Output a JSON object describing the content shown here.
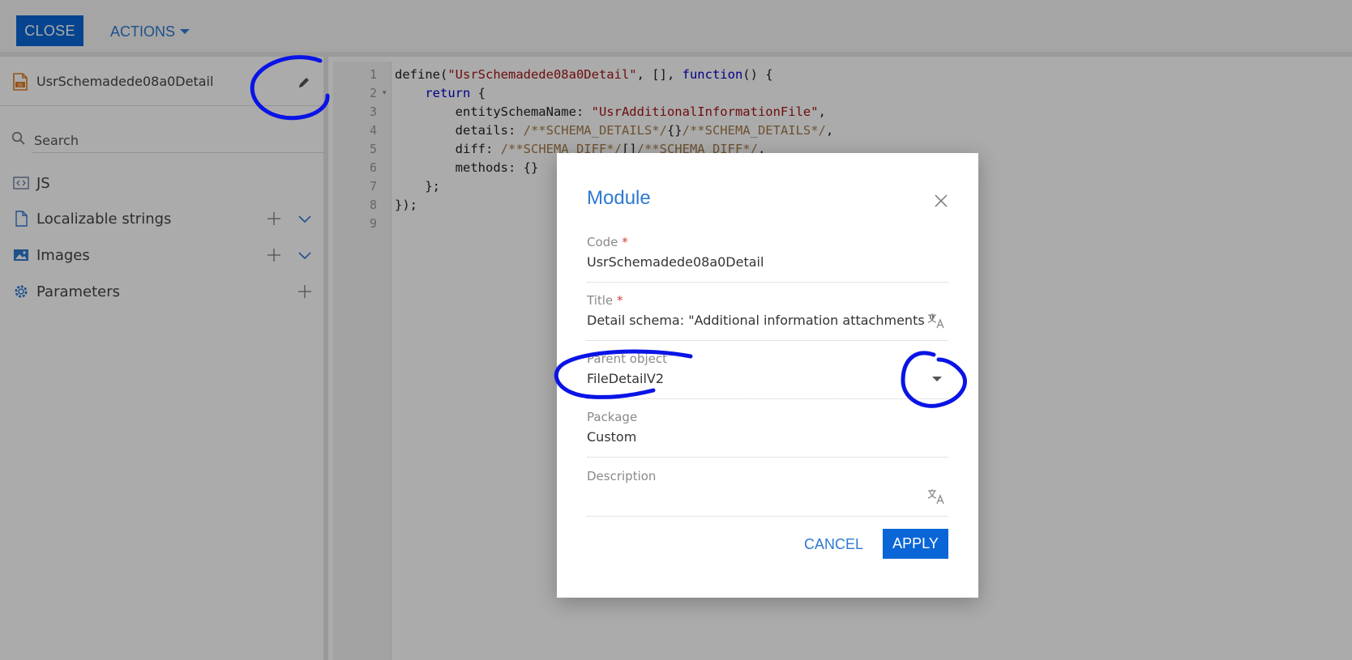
{
  "toolbar": {
    "close_label": "CLOSE",
    "actions_label": "ACTIONS"
  },
  "sidebar": {
    "schema_name": "UsrSchemadede08a0Detail",
    "search_placeholder": "Search",
    "items": [
      {
        "label": "JS"
      },
      {
        "label": "Localizable strings"
      },
      {
        "label": "Images"
      },
      {
        "label": "Parameters"
      }
    ]
  },
  "editor": {
    "line_numbers": [
      "1",
      "2",
      "3",
      "4",
      "5",
      "6",
      "7",
      "8",
      "9"
    ],
    "lines": {
      "l1_a": "define(",
      "l1_b": "\"UsrSchemadede08a0Detail\"",
      "l1_c": ", [], ",
      "l1_d": "function",
      "l1_e": "() {",
      "l2_a": "    ",
      "l2_b": "return",
      "l2_c": " {",
      "l3_a": "        entitySchemaName: ",
      "l3_b": "\"UsrAdditionalInformationFile\"",
      "l3_c": ",",
      "l4_a": "        details: ",
      "l4_b": "/**SCHEMA_DETAILS*/",
      "l4_c": "{}",
      "l4_d": "/**SCHEMA_DETAILS*/",
      "l4_e": ",",
      "l5_a": "        diff: ",
      "l5_b": "/**SCHEMA_DIFF*/",
      "l5_c": "[]",
      "l5_d": "/**SCHEMA_DIFF*/",
      "l5_e": ",",
      "l6": "        methods: {}",
      "l7": "    };",
      "l8": "});"
    }
  },
  "modal": {
    "title": "Module",
    "fields": {
      "code": {
        "label": "Code",
        "required_mark": "*",
        "value": "UsrSchemadede08a0Detail"
      },
      "title": {
        "label": "Title",
        "required_mark": "*",
        "value": "Detail schema: \"Additional information attachments \""
      },
      "parent": {
        "label": "Parent object",
        "value": "FileDetailV2"
      },
      "package": {
        "label": "Package",
        "value": "Custom"
      },
      "description": {
        "label": "Description",
        "value": ""
      }
    },
    "cancel_label": "CANCEL",
    "apply_label": "APPLY"
  },
  "colors": {
    "primary": "#0a66d6",
    "link": "#2e7ad1",
    "required": "#d0413c",
    "annotation": "#0a14e6"
  }
}
